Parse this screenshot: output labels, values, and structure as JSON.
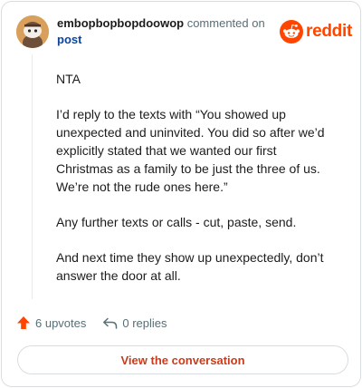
{
  "header": {
    "username": "embopbopbopdoowop",
    "action": "commented on",
    "post_link": "post",
    "logo_text": "reddit"
  },
  "comment": {
    "paragraphs": [
      "NTA",
      "I’d reply to the texts with “You showed up unexpected and uninvited. You did so after we’d explicitly stated that we wanted our first Christmas as a family to be just the three of us. We’re not the rude ones here.”",
      "Any further texts or calls - cut, paste, send.",
      "And next time they show up unexpectedly, don’t answer the door at all."
    ]
  },
  "footer": {
    "upvotes": "6 upvotes",
    "replies": "0 replies",
    "cta": "View the conversation"
  },
  "icons": {
    "avatar": "snoo-avatar-icon",
    "logo": "reddit-logo-icon",
    "upvote": "upvote-arrow-icon",
    "reply": "reply-arrow-icon"
  },
  "colors": {
    "brand": "#ff4500",
    "link": "#0a449b",
    "cta_text": "#c93c1b",
    "muted": "#576f76"
  }
}
